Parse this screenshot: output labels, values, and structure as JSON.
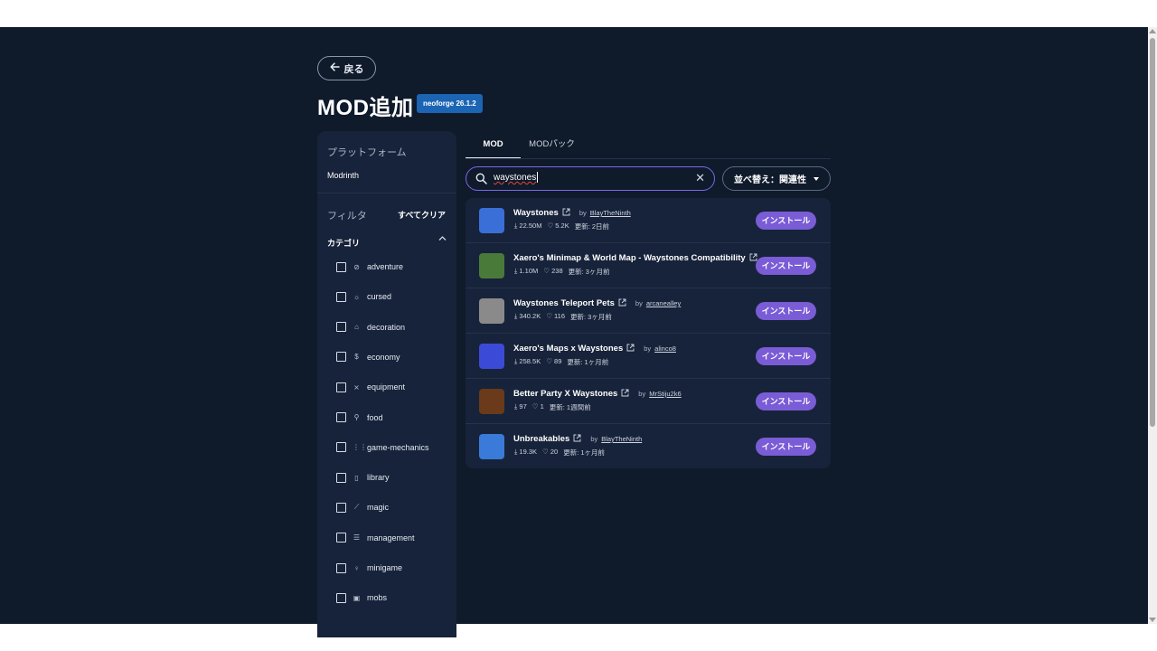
{
  "header": {
    "back_label": "戻る",
    "title": "MOD追加",
    "version_badge": "neoforge 26.1.2"
  },
  "sidebar": {
    "platform_label": "プラットフォーム",
    "platform_value": "Modrinth",
    "filter_label": "フィルタ",
    "clear_all": "すべてクリア",
    "category_label": "カテゴリ",
    "categories": [
      {
        "icon": "compass-icon",
        "glyph": "⊘",
        "label": "adventure"
      },
      {
        "icon": "bug-icon",
        "glyph": "☼",
        "label": "cursed"
      },
      {
        "icon": "house-icon",
        "glyph": "⌂",
        "label": "decoration"
      },
      {
        "icon": "dollar-icon",
        "glyph": "$",
        "label": "economy"
      },
      {
        "icon": "swords-icon",
        "glyph": "⨯",
        "label": "equipment"
      },
      {
        "icon": "carrot-icon",
        "glyph": "⚲",
        "label": "food"
      },
      {
        "icon": "sliders-icon",
        "glyph": "⋮⋮",
        "label": "game-mechanics"
      },
      {
        "icon": "book-icon",
        "glyph": "▯",
        "label": "library"
      },
      {
        "icon": "wand-icon",
        "glyph": "⟋",
        "label": "magic"
      },
      {
        "icon": "server-icon",
        "glyph": "☰",
        "label": "management"
      },
      {
        "icon": "trophy-icon",
        "glyph": "♀",
        "label": "minigame"
      },
      {
        "icon": "mob-icon",
        "glyph": "▣",
        "label": "mobs"
      }
    ]
  },
  "tabs": [
    {
      "label": "MOD",
      "active": true
    },
    {
      "label": "MODパック",
      "active": false
    }
  ],
  "search": {
    "value": "waystones",
    "placeholder": ""
  },
  "sort": {
    "label": "並べ替え：関連性"
  },
  "results": [
    {
      "name": "Waystones",
      "author": "BlayTheNinth",
      "downloads": "22.50M",
      "follows": "5.2K",
      "updated": "更新: 2日前",
      "icon": "waystone-icon",
      "color": "#3a6fd8"
    },
    {
      "name": "Xaero's Minimap & World Map - Waystones Compatibility",
      "author": "",
      "downloads": "1.10M",
      "follows": "238",
      "updated": "更新: 3ヶ月前",
      "icon": "minimap-icon",
      "color": "#4a7a3a"
    },
    {
      "name": "Waystones Teleport Pets",
      "author": "arcanealley",
      "downloads": "340.2K",
      "follows": "116",
      "updated": "更新: 3ヶ月前",
      "icon": "pet-statue-icon",
      "color": "#8a8a8a"
    },
    {
      "name": "Xaero's Maps x Waystones",
      "author": "alinco8",
      "downloads": "258.5K",
      "follows": "89",
      "updated": "更新: 1ヶ月前",
      "icon": "maps-icon",
      "color": "#3c4ad8"
    },
    {
      "name": "Better Party X Waystones",
      "author": "MrStiju2k6",
      "downloads": "97",
      "follows": "1",
      "updated": "更新: 1週間前",
      "icon": "party-icon",
      "color": "#6a3a1a"
    },
    {
      "name": "Unbreakables",
      "author": "BlayTheNinth",
      "downloads": "19.3K",
      "follows": "20",
      "updated": "更新: 1ヶ月前",
      "icon": "unbreakable-icon",
      "color": "#3a7ad8"
    }
  ],
  "labels": {
    "by": "by",
    "install": "インストール"
  },
  "colors": {
    "background": "#0f1a2b",
    "panel": "#17233a",
    "accent": "#7a5cd6",
    "badge": "#1c64b4"
  }
}
